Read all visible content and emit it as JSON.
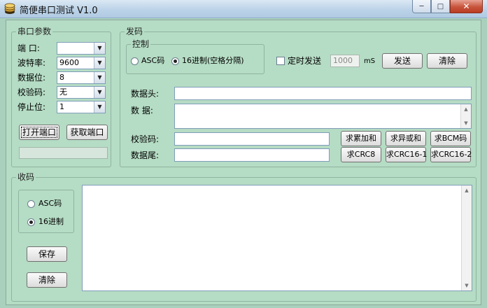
{
  "window": {
    "title": "简便串口测试 V1.0",
    "controls": {
      "minimize": "─",
      "maximize": "□",
      "close": "✕"
    }
  },
  "serial": {
    "group_title": "串口参数",
    "port_label": "端  口:",
    "port_value": "",
    "baud_label": "波特率:",
    "baud_value": "9600",
    "databits_label": "数据位:",
    "databits_value": "8",
    "parity_label": "校验码:",
    "parity_value": "无",
    "stopbits_label": "停止位:",
    "stopbits_value": "1",
    "open_button": "打开端口",
    "fetch_button": "获取端口"
  },
  "send": {
    "group_title": "发码",
    "control": {
      "group_title": "控制",
      "asc_label": "ASC码",
      "hex_label": "16进制(空格分隔)",
      "timer_label": "定时发送",
      "interval_value": "1000",
      "interval_unit": "mS",
      "send_button": "发送",
      "clear_button": "清除"
    },
    "header_label": "数据头:",
    "data_label": "数  据:",
    "checksum_label": "校验码:",
    "tail_label": "数据尾:",
    "header_value": "",
    "data_value": "",
    "checksum_value": "",
    "tail_value": "",
    "buttons": {
      "sum": "求累加和",
      "xor": "求异或和",
      "bcm": "求BCM码",
      "crc8": "求CRC8",
      "crc16_1": "求CRC16-1",
      "crc16_2": "求CRC16-2"
    }
  },
  "receive": {
    "group_title": "收码",
    "asc_label": "ASC码",
    "hex_label": "16进制",
    "save_button": "保存",
    "clear_button": "清除",
    "content": ""
  },
  "state": {
    "send_mode": "hex",
    "timer_enabled": false,
    "receive_mode": "hex"
  },
  "icons": {
    "app": "coin-stack-icon",
    "scroll_up": "arrow-up-icon",
    "scroll_down": "arrow-down-icon"
  },
  "colors": {
    "background": "#b5dcc4",
    "titlebar": "#bcd3e8",
    "close_button": "#c8543c"
  }
}
